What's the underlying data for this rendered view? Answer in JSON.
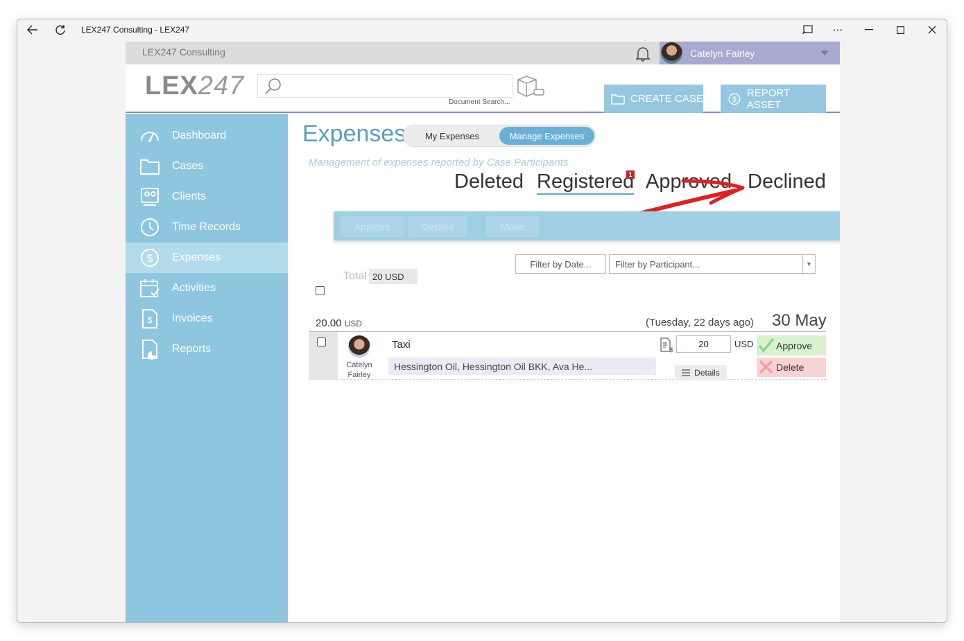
{
  "window": {
    "title": "LEX247 Consulting - LEX247"
  },
  "topbar": {
    "org_name": "LEX247 Consulting",
    "user_name": "Catelyn Fairley"
  },
  "header": {
    "logo_bold": "LEX",
    "logo_light": "247",
    "search_placeholder": "",
    "search_label": "Document Search...",
    "create_case": "CREATE CASE",
    "report_asset": "REPORT ASSET"
  },
  "sidebar": {
    "items": [
      {
        "label": "Dashboard",
        "icon": "gauge-icon"
      },
      {
        "label": "Cases",
        "icon": "folder-icon"
      },
      {
        "label": "Clients",
        "icon": "clients-icon"
      },
      {
        "label": "Time Records",
        "icon": "clock-icon"
      },
      {
        "label": "Expenses",
        "icon": "dollar-circle-icon",
        "active": true
      },
      {
        "label": "Activities",
        "icon": "calendar-check-icon"
      },
      {
        "label": "Invoices",
        "icon": "invoice-icon"
      },
      {
        "label": "Reports",
        "icon": "report-chart-icon"
      }
    ]
  },
  "page": {
    "title": "Expenses",
    "toggle": {
      "my": "My Expenses",
      "manage": "Manage Expenses",
      "selected": "Manage Expenses"
    },
    "subtitle": "Management of expenses reported by Case Participants",
    "status_tabs": {
      "deleted": "Deleted",
      "registered": "Registered",
      "approved": "Approved",
      "declined": "Declined",
      "active": "Registered",
      "registered_badge": "1"
    },
    "actions": {
      "approve": "Approve",
      "decline": "Decline",
      "move": "Move"
    },
    "filters": {
      "date_placeholder": "Filter by Date...",
      "participant_placeholder": "Filter by Participant..."
    },
    "total": {
      "label": "Total",
      "value": "20 USD"
    }
  },
  "expense_group": {
    "amount": "20.00",
    "currency": "USD",
    "relative": "(Tuesday, 22 days ago)",
    "date": "30 May",
    "items": [
      {
        "user_first": "Catelyn",
        "user_last": "Fairley",
        "title": "Taxi",
        "participants": "Hessington Oil, Hessington Oil BKK, Ava He...",
        "amount": "20",
        "currency": "USD",
        "details": "Details",
        "approve": "Approve",
        "delete": "Delete"
      }
    ]
  },
  "colors": {
    "sidebar": "#8ec6e0",
    "sidebar_active": "#b2dbec",
    "accent": "#5a9ec3",
    "toggle_active": "#6ab0d6",
    "user_bar": "#a7a9d0",
    "approve_bg": "#d8f2d0",
    "delete_bg": "#f7d3d3",
    "annotation_arrow": "#e02020"
  }
}
